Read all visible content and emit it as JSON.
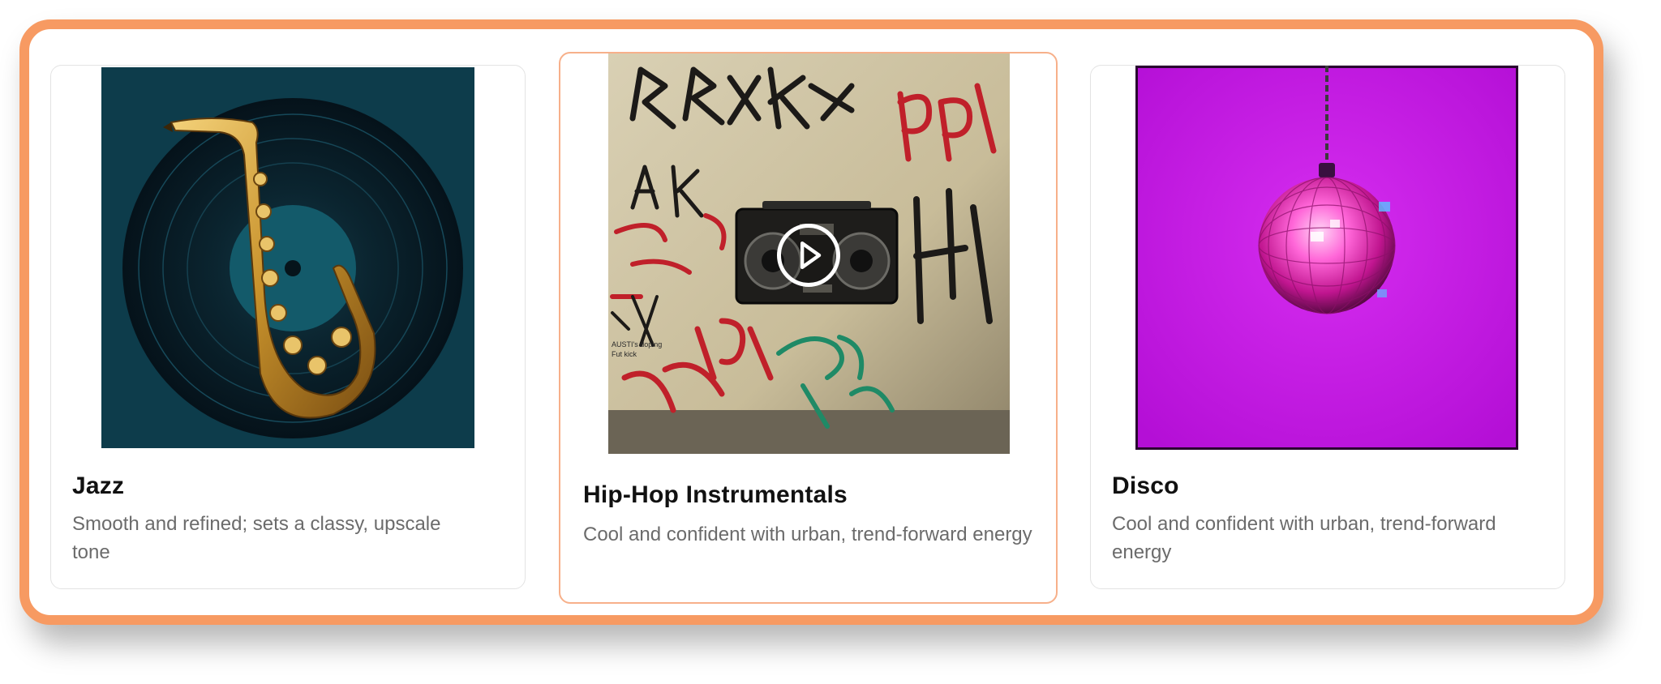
{
  "cards": [
    {
      "title": "Jazz",
      "description": "Smooth and refined; sets a classy, upscale tone",
      "image": "saxophone-on-vinyl-record",
      "selected": false
    },
    {
      "title": "Hip-Hop Instrumentals",
      "description": "Cool and confident with urban, trend-forward energy",
      "image": "boombox-on-graffiti-wall",
      "selected": true,
      "graffiti_small_text": "AUSTI's doping\nFut kick"
    },
    {
      "title": "Disco",
      "description": "Cool and confident with urban, trend-forward energy",
      "image": "disco-ball-on-magenta",
      "selected": false
    }
  ],
  "colors": {
    "frame_border": "#f79a62",
    "selected_border": "#f7b08a",
    "title": "#111111",
    "description": "#6b6b6b"
  },
  "icons": {
    "play": "play-circle-icon"
  }
}
